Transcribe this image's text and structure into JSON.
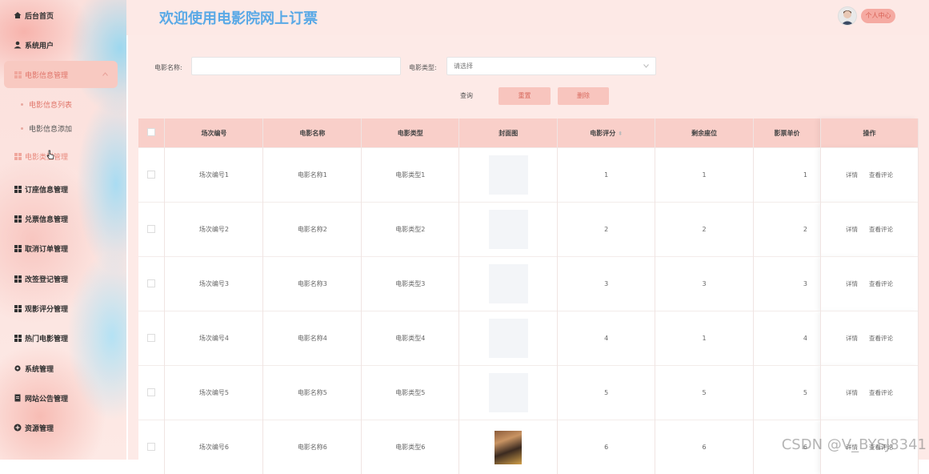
{
  "sidebar": {
    "items": [
      {
        "label": "后台首页",
        "icon": "home-icon"
      },
      {
        "label": "系统用户",
        "icon": "user-icon"
      },
      {
        "label": "电影信息管理",
        "icon": "grid-icon"
      },
      {
        "label": "电影信息列表"
      },
      {
        "label": "电影信息添加"
      },
      {
        "label": "电影类型管理",
        "icon": "grid-icon"
      },
      {
        "label": "订座信息管理",
        "icon": "grid-icon"
      },
      {
        "label": "兑票信息管理",
        "icon": "grid-icon"
      },
      {
        "label": "取消订单管理",
        "icon": "grid-icon"
      },
      {
        "label": "改签登记管理",
        "icon": "grid-icon"
      },
      {
        "label": "观影评分管理",
        "icon": "grid-icon"
      },
      {
        "label": "热门电影管理",
        "icon": "grid-icon"
      },
      {
        "label": "系统管理",
        "icon": "gear-icon"
      },
      {
        "label": "网站公告管理",
        "icon": "document-icon"
      },
      {
        "label": "资源管理",
        "icon": "plus-circle-icon"
      }
    ]
  },
  "header": {
    "title": "欢迎使用电影院网上订票",
    "user_button": "个人中心"
  },
  "search": {
    "name_label": "电影名称:",
    "name_value": "",
    "type_label": "电影类型:",
    "type_placeholder": "请选择",
    "query_label": "查询",
    "reset_label": "重置",
    "delete_label": "删除"
  },
  "table": {
    "headers": [
      "场次编号",
      "电影名称",
      "电影类型",
      "封面图",
      "电影评分",
      "剩余座位",
      "影票单价",
      "操作"
    ],
    "rows": [
      {
        "id": "场次编号1",
        "name": "电影名称1",
        "type": "电影类型1",
        "score": "1",
        "seats": "1",
        "price": "1"
      },
      {
        "id": "场次编号2",
        "name": "电影名称2",
        "type": "电影类型2",
        "score": "2",
        "seats": "2",
        "price": "2"
      },
      {
        "id": "场次编号3",
        "name": "电影名称3",
        "type": "电影类型3",
        "score": "3",
        "seats": "3",
        "price": "3"
      },
      {
        "id": "场次编号4",
        "name": "电影名称4",
        "type": "电影类型4",
        "score": "4",
        "seats": "1",
        "price": "4"
      },
      {
        "id": "场次编号5",
        "name": "电影名称5",
        "type": "电影类型5",
        "score": "5",
        "seats": "5",
        "price": "5"
      },
      {
        "id": "场次编号6",
        "name": "电影名称6",
        "type": "电影类型6",
        "score": "6",
        "seats": "6",
        "price": "6"
      }
    ],
    "op_detail": "详情",
    "op_comment": "查看评论"
  },
  "watermark": "CSDN @V_BYSJ8341"
}
